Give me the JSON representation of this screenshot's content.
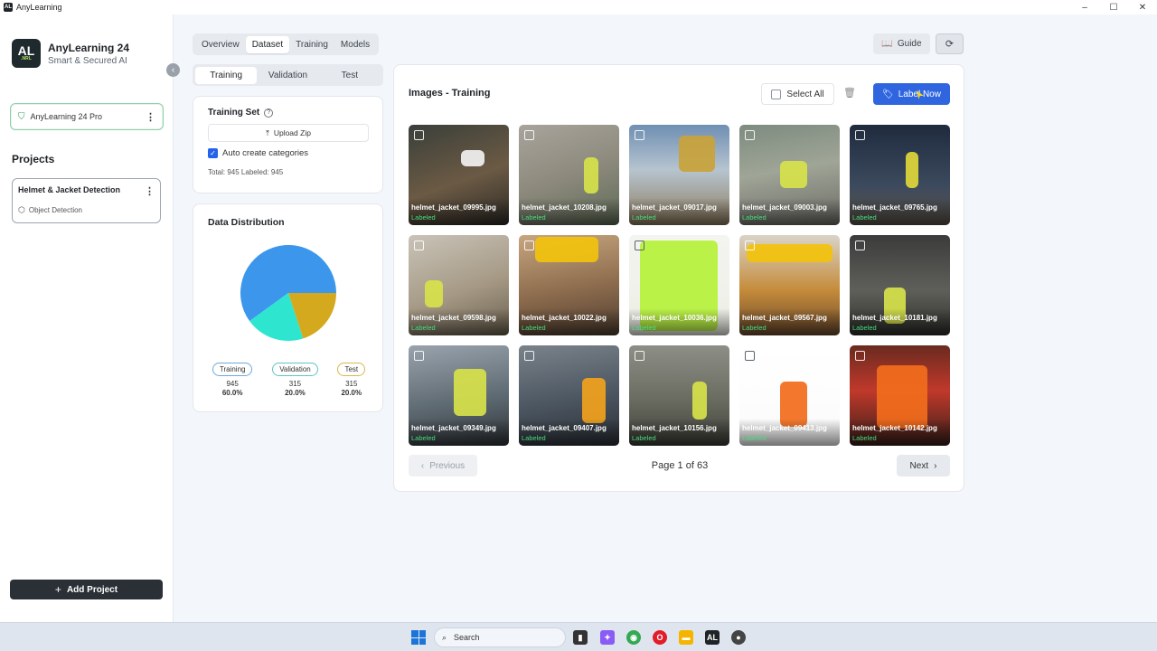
{
  "window": {
    "title": "AnyLearning",
    "app_icon": "AL",
    "controls": [
      "–",
      "☐",
      "✕"
    ]
  },
  "brand": {
    "logo_main": "AL",
    "logo_sub": ".NRL",
    "title": "AnyLearning 24",
    "subtitle": "Smart & Secured AI"
  },
  "license": {
    "label": "AnyLearning 24 Pro",
    "icon": "shield-icon"
  },
  "projects": {
    "heading": "Projects",
    "items": [
      {
        "name": "Helmet & Jacket Detection",
        "type": "Object Detection"
      }
    ]
  },
  "add_project_label": "Add Project",
  "top_tabs": [
    {
      "label": "Overview",
      "active": false
    },
    {
      "label": "Dataset",
      "active": true
    },
    {
      "label": "Training",
      "active": false
    },
    {
      "label": "Models",
      "active": false
    }
  ],
  "guide_label": "Guide",
  "sub_tabs": [
    {
      "label": "Training",
      "active": true
    },
    {
      "label": "Validation",
      "active": false
    },
    {
      "label": "Test",
      "active": false
    }
  ],
  "training_set": {
    "heading": "Training Set",
    "upload_label": "Upload Zip",
    "auto_label": "Auto create categories",
    "auto_checked": true,
    "totals": "Total: 945   Labeled: 945"
  },
  "distribution": {
    "heading": "Data Distribution",
    "segments": [
      {
        "name": "Training",
        "count": "945",
        "pct": "60.0%",
        "value": 60,
        "color": "#3b96ec",
        "border": "#6fa8dc"
      },
      {
        "name": "Validation",
        "count": "315",
        "pct": "20.0%",
        "value": 20,
        "color": "#2ee6d0",
        "border": "#5ec6c2"
      },
      {
        "name": "Test",
        "count": "315",
        "pct": "20.0%",
        "value": 20,
        "color": "#d4a91d",
        "border": "#d8b84a"
      }
    ]
  },
  "images": {
    "title": "Images - Training",
    "select_all": "Select All",
    "label_now": "Label Now",
    "status": "Labeled",
    "items": [
      {
        "name": "helmet_jacket_09995.jpg"
      },
      {
        "name": "helmet_jacket_10208.jpg"
      },
      {
        "name": "helmet_jacket_09017.jpg"
      },
      {
        "name": "helmet_jacket_09003.jpg"
      },
      {
        "name": "helmet_jacket_09765.jpg"
      },
      {
        "name": "helmet_jacket_09598.jpg"
      },
      {
        "name": "helmet_jacket_10022.jpg"
      },
      {
        "name": "helmet_jacket_10036.jpg"
      },
      {
        "name": "helmet_jacket_09567.jpg"
      },
      {
        "name": "helmet_jacket_10181.jpg"
      },
      {
        "name": "helmet_jacket_09349.jpg"
      },
      {
        "name": "helmet_jacket_09407.jpg"
      },
      {
        "name": "helmet_jacket_10156.jpg"
      },
      {
        "name": "helmet_jacket_09413.jpg"
      },
      {
        "name": "helmet_jacket_10142.jpg"
      }
    ]
  },
  "pagination": {
    "prev": "Previous",
    "page": "Page 1 of 63",
    "next": "Next"
  },
  "taskbar": {
    "search": "Search"
  }
}
